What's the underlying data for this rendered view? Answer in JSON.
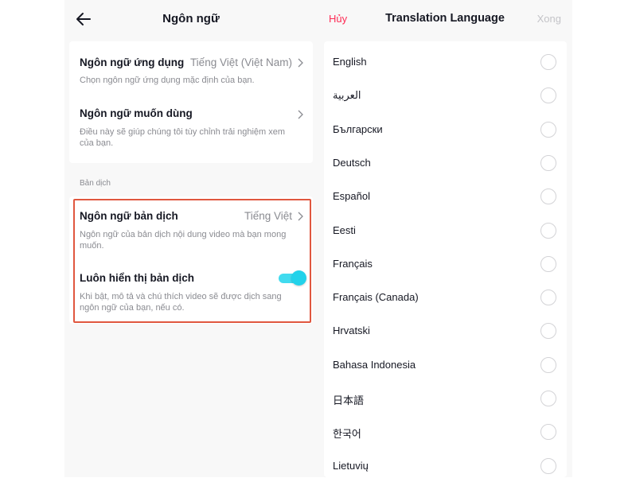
{
  "left": {
    "title": "Ngôn ngữ",
    "app_language": {
      "label": "Ngôn ngữ ứng dụng",
      "value": "Tiếng Việt (Việt Nam)",
      "description": "Chọn ngôn ngữ ứng dụng mặc định của bạn."
    },
    "preferred_language": {
      "label": "Ngôn ngữ muốn dùng",
      "description_line1": "Điều này sẽ giúp chúng tôi tùy chỉnh trải nghiệm xem",
      "description_line2": "của bạn."
    },
    "section_label": "Bản dịch",
    "translation_language": {
      "label": "Ngôn ngữ bản dịch",
      "value": "Tiếng Việt",
      "description_line1": "Ngôn ngữ của bản dịch nội dung video mà bạn mong",
      "description_line2": "muốn."
    },
    "always_show_translation": {
      "label": "Luôn hiển thị bản dịch",
      "enabled": true,
      "description_line1": "Khi bật, mô tả và chú thích video sẽ được dịch sang",
      "description_line2": "ngôn ngữ của bạn, nếu có."
    }
  },
  "right": {
    "cancel_label": "Hủy",
    "title": "Translation Language",
    "done_label": "Xong",
    "languages": [
      "English",
      "العربية",
      "Български",
      "Deutsch",
      "Español",
      "Eesti",
      "Français",
      "Français (Canada)",
      "Hrvatski",
      "Bahasa Indonesia",
      "日本語",
      "한국어",
      "Lietuvių"
    ]
  },
  "colors": {
    "accent_red": "#fe2c55",
    "toggle_on": "#20d5ec",
    "highlight_border": "#e0573f"
  }
}
